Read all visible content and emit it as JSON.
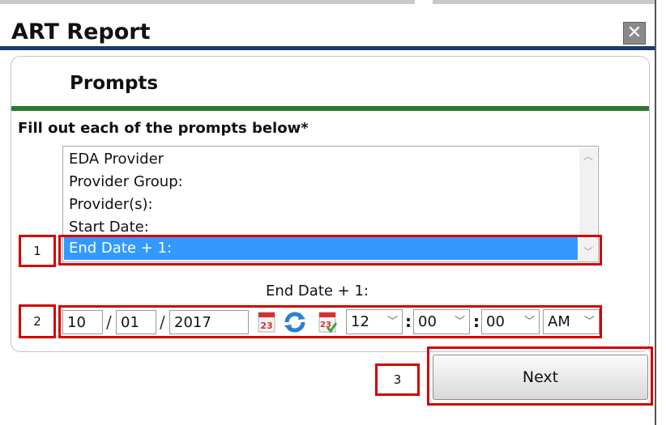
{
  "window": {
    "title": "ART Report",
    "close_glyph": "✕",
    "close_icon": "close-icon"
  },
  "prompts": {
    "header": "Prompts",
    "instructions": "Fill out each of the prompts below",
    "required_marker": "*"
  },
  "prompt_list": {
    "items": [
      {
        "label": "EDA Provider",
        "selected": false
      },
      {
        "label": "Provider Group:",
        "selected": false
      },
      {
        "label": "Provider(s):",
        "selected": false
      },
      {
        "label": "Start Date:",
        "selected": false
      },
      {
        "label": "End Date + 1:",
        "selected": true
      }
    ],
    "selected_color": "#3399ff"
  },
  "date_entry": {
    "field_label": "End Date + 1:",
    "month": "10",
    "day": "01",
    "year": "2017",
    "date_separator": "/",
    "time_separator": ":",
    "hour": "12",
    "minute": "00",
    "second": "00",
    "ampm": "AM",
    "calendar_number": "23"
  },
  "actions": {
    "next_label": "Next"
  },
  "annotations": {
    "callout_1": "1",
    "callout_2": "2",
    "callout_3": "3",
    "highlight_color": "#d40000"
  },
  "colors": {
    "title_rule": "#1d3b69",
    "section_rule": "#2b7a2b"
  }
}
